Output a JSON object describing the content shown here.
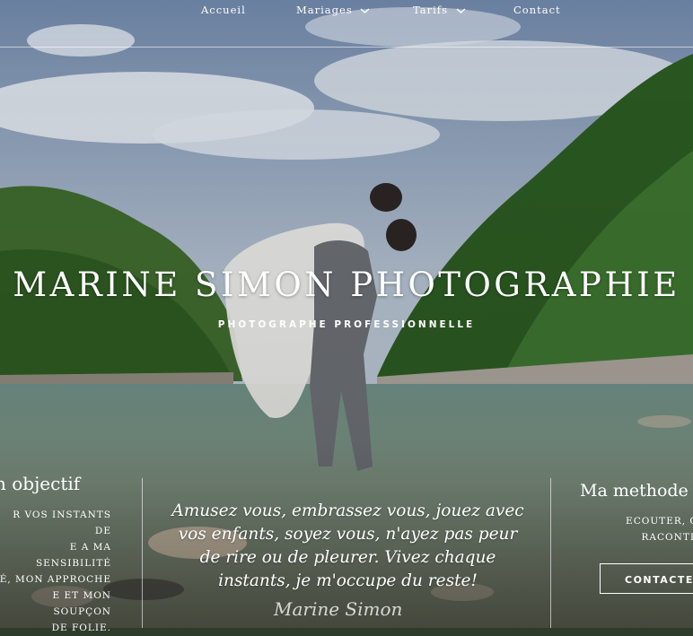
{
  "nav": {
    "items": [
      {
        "label": "Accueil"
      },
      {
        "label": "Mariages"
      },
      {
        "label": "Tarifs"
      },
      {
        "label": "Contact"
      }
    ]
  },
  "hero": {
    "title": "MARINE SIMON PHOTOGRAPHIE",
    "subtitle": "PHOTOGRAPHE PROFESSIONNELLE"
  },
  "left_column": {
    "heading": "n objectif",
    "text": "R VOS INSTANTS DE\nE A MA SENSIBILITÉ\nÉ, MON APPROCHE\nE ET MON SOUPÇON\nDE FOLIE."
  },
  "quote": {
    "text": "Amusez vous, embrassez vous, jouez avec vos enfants, soyez vous, n'ayez pas peur de rire ou de pleurer. Vivez chaque instants, je m'occupe du reste!",
    "signature": "Marine Simon"
  },
  "right_column": {
    "heading": "Ma methode c",
    "text": "ECOUTER, OBS\nRACONTE",
    "button": "CONTACTEZ"
  },
  "colors": {
    "sky": "#8ea3bf",
    "forest": "#2f5a24",
    "river": "#6f8a78",
    "text": "#ffffff"
  }
}
